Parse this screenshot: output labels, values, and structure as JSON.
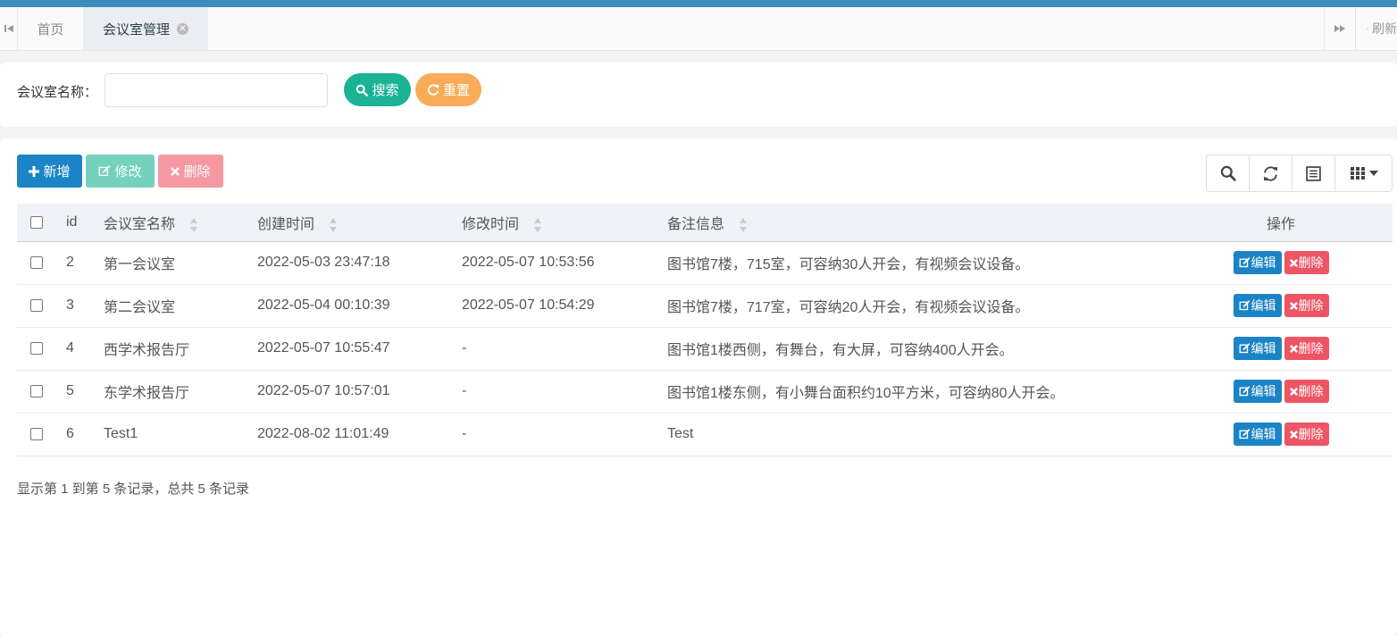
{
  "tabs": {
    "home": "首页",
    "active": "会议室管理",
    "refresh": "刷新"
  },
  "search": {
    "label": "会议室名称：",
    "input_value": "",
    "search_button": "搜索",
    "reset_button": "重置"
  },
  "toolbar": {
    "add": "新增",
    "edit": "修改",
    "delete": "删除"
  },
  "table": {
    "headers": {
      "id": "id",
      "name": "会议室名称",
      "created": "创建时间",
      "modified": "修改时间",
      "remark": "备注信息",
      "ops": "操作"
    },
    "rows": [
      {
        "id": "2",
        "name": "第一会议室",
        "created": "2022-05-03 23:47:18",
        "modified": "2022-05-07 10:53:56",
        "remark": "图书馆7楼，715室，可容纳30人开会，有视频会议设备。",
        "edit": "编辑",
        "delete": "删除"
      },
      {
        "id": "3",
        "name": "第二会议室",
        "created": "2022-05-04 00:10:39",
        "modified": "2022-05-07 10:54:29",
        "remark": "图书馆7楼，717室，可容纳20人开会，有视频会议设备。",
        "edit": "编辑",
        "delete": "删除"
      },
      {
        "id": "4",
        "name": "西学术报告厅",
        "created": "2022-05-07 10:55:47",
        "modified": "-",
        "remark": "图书馆1楼西侧，有舞台，有大屏，可容纳400人开会。",
        "edit": "编辑",
        "delete": "删除"
      },
      {
        "id": "5",
        "name": "东学术报告厅",
        "created": "2022-05-07 10:57:01",
        "modified": "-",
        "remark": "图书馆1楼东侧，有小舞台面积约10平方米，可容纳80人开会。",
        "edit": "编辑",
        "delete": "删除"
      },
      {
        "id": "6",
        "name": "Test1",
        "created": "2022-08-02 11:01:49",
        "modified": "-",
        "remark": "Test",
        "edit": "编辑",
        "delete": "删除"
      }
    ]
  },
  "pagination": {
    "summary": "显示第 1 到第 5 条记录，总共 5 条记录"
  },
  "colors": {
    "primary": "#1c84c6",
    "success": "#1ab394",
    "warning": "#f8ac59",
    "danger": "#ed5565",
    "topbar": "#3c8dbc"
  },
  "icons": [
    "backward-icon",
    "close-circle-icon",
    "forward-icon",
    "refresh-icon",
    "search-icon",
    "plus-icon",
    "edit-icon",
    "times-icon",
    "list-icon",
    "columns-icon",
    "caret-down-icon",
    "sort-icon"
  ]
}
